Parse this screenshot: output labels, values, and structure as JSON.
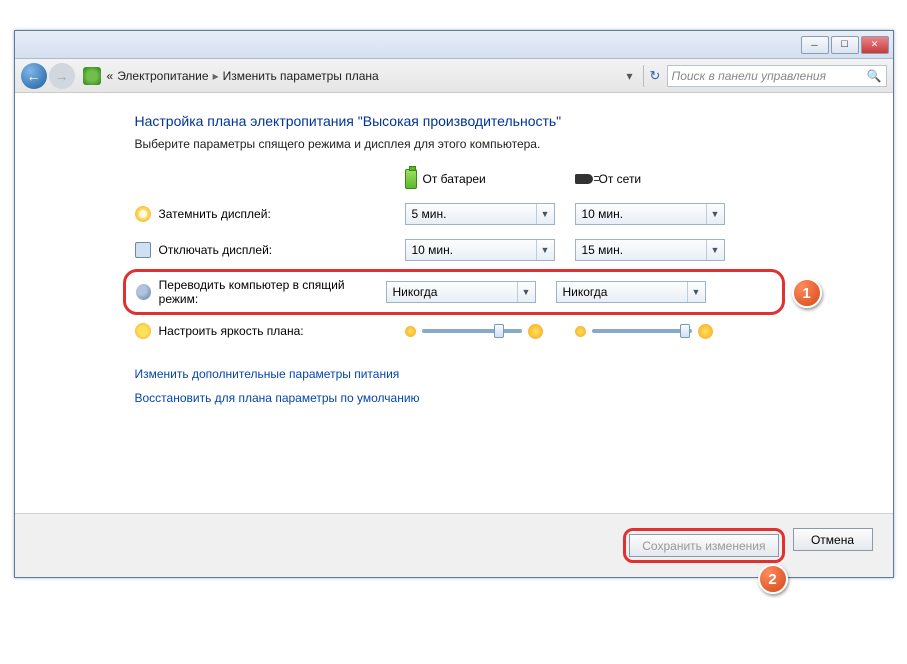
{
  "breadcrumb": {
    "item1": "Электропитание",
    "item2": "Изменить параметры плана"
  },
  "search": {
    "placeholder": "Поиск в панели управления"
  },
  "page": {
    "title": "Настройка плана электропитания \"Высокая производительность\"",
    "subtitle": "Выберите параметры спящего режима и дисплея для этого компьютера."
  },
  "columns": {
    "battery": "От батареи",
    "plugged": "От сети"
  },
  "settings": {
    "dim_display": {
      "label": "Затемнить дисплей:",
      "battery": "5 мин.",
      "plugged": "10 мин."
    },
    "turn_off_display": {
      "label": "Отключать дисплей:",
      "battery": "10 мин.",
      "plugged": "15 мин."
    },
    "sleep": {
      "label": "Переводить компьютер в спящий режим:",
      "battery": "Никогда",
      "plugged": "Никогда"
    },
    "brightness": {
      "label": "Настроить яркость плана:"
    }
  },
  "links": {
    "advanced": "Изменить дополнительные параметры питания",
    "restore": "Восстановить для плана параметры по умолчанию"
  },
  "buttons": {
    "save": "Сохранить изменения",
    "cancel": "Отмена"
  },
  "callouts": {
    "one": "1",
    "two": "2"
  }
}
